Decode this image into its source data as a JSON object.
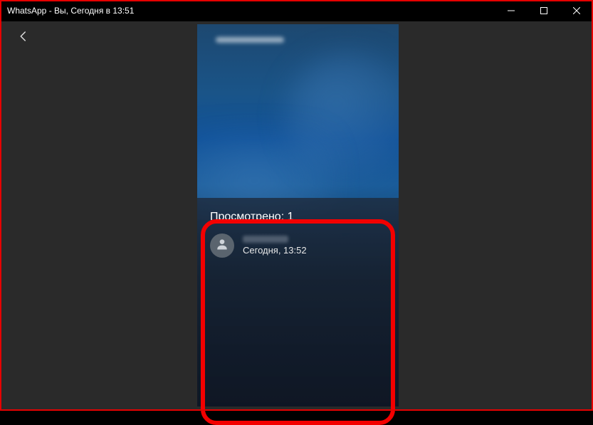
{
  "window": {
    "title": "WhatsApp - Вы, Сегодня в 13:51"
  },
  "panel": {
    "viewed_label": "Просмотрено: 1",
    "viewer": {
      "timestamp": "Сегодня, 13:52"
    }
  }
}
